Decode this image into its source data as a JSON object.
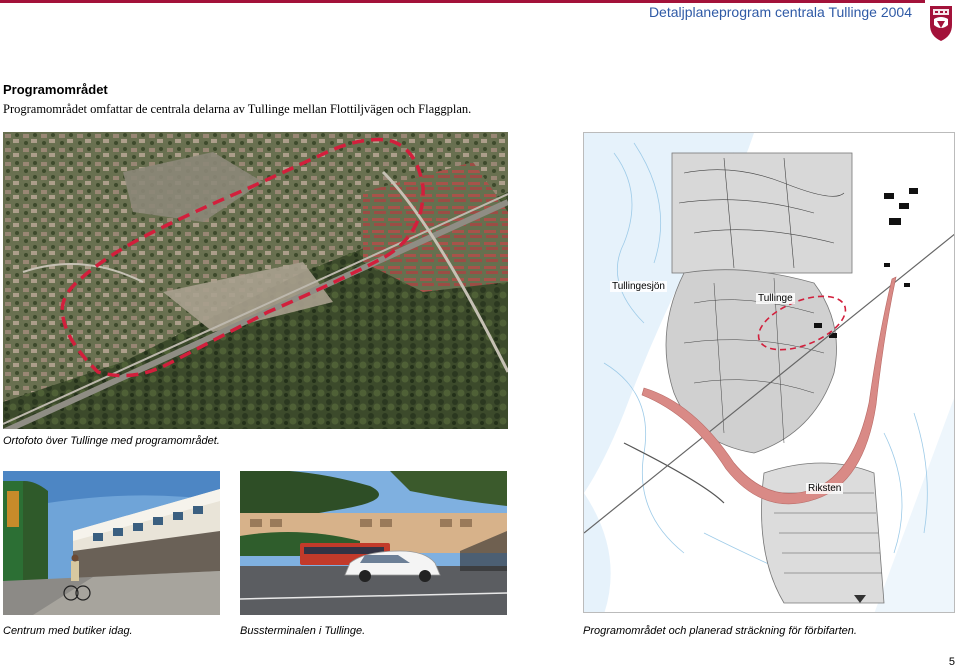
{
  "header": {
    "doc_title": "Detaljplaneprogram centrala Tullinge 2004"
  },
  "section": {
    "title": "Programområdet",
    "text": "Programområdet omfattar de centrala delarna av Tullinge mellan Flottiljvägen och Flaggplan."
  },
  "map": {
    "labels": [
      "Tullingesjön",
      "Tullinge",
      "Riksten"
    ]
  },
  "captions": {
    "orthophoto": "Ortofoto över Tullinge med programområdet.",
    "centrum": "Centrum med butiker idag.",
    "bus": "Bussterminalen i Tullinge.",
    "map": "Programområdet och planerad sträckning för förbifarten."
  },
  "page_number": "5",
  "colors": {
    "accent": "#a3123a",
    "header_text": "#2f5aa6",
    "boundary": "#d21f3c",
    "bypass": "#d98a86"
  },
  "icons": {
    "logo": "municipality-crest-icon"
  }
}
